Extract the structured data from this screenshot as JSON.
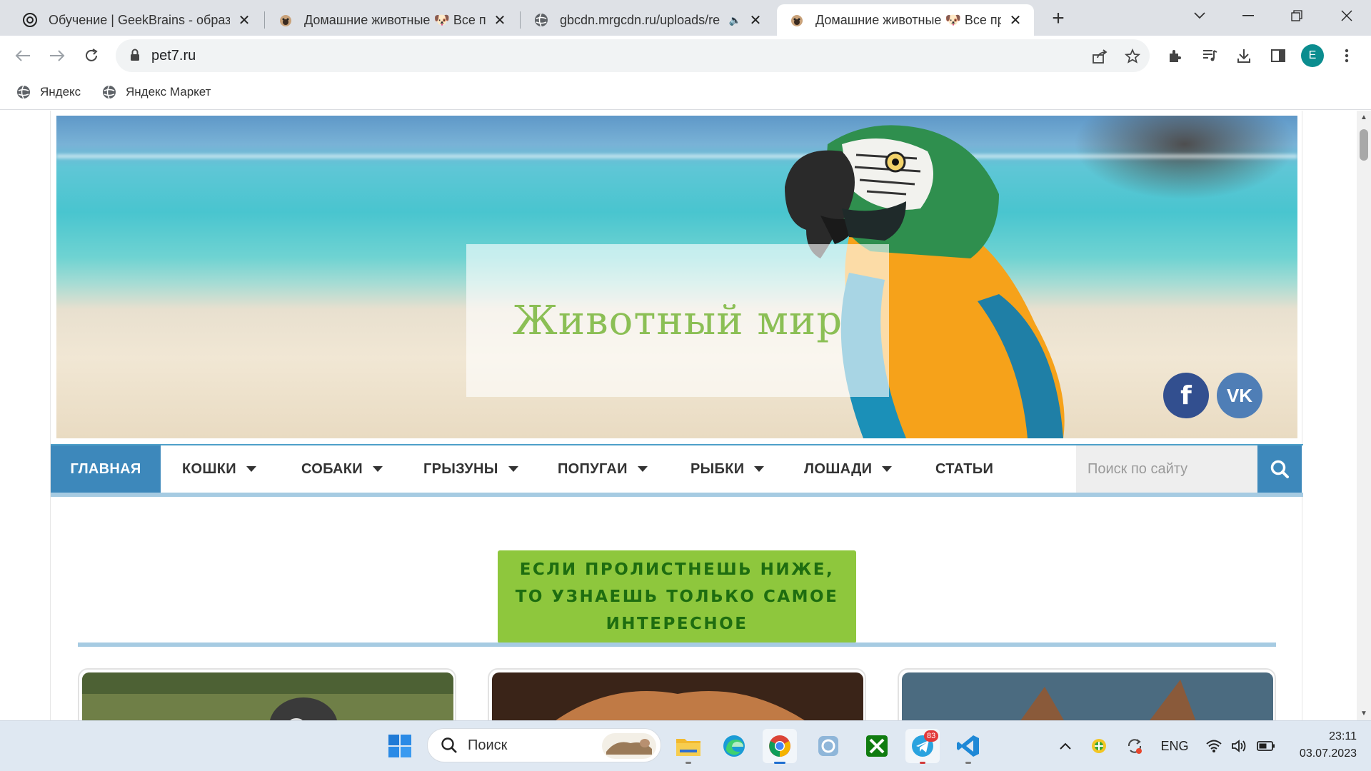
{
  "browser": {
    "tabs": [
      {
        "title": "Обучение | GeekBrains - образо",
        "active": false
      },
      {
        "title": "Домашние животные 🐶 Все пр",
        "active": false
      },
      {
        "title": "gbcdn.mrgcdn.ru/uploads/re",
        "active": false
      },
      {
        "title": "Домашние животные 🐶 Все пр",
        "active": true
      }
    ],
    "url": "pet7.ru",
    "profile_initial": "E",
    "bookmarks": [
      "Яндекс",
      "Яндекс Маркет"
    ]
  },
  "site": {
    "hero_title": "Животный мир",
    "social": {
      "fb_label": "f",
      "vk_label": "VK"
    },
    "nav": [
      {
        "label": "ГЛАВНАЯ",
        "dropdown": false,
        "active": true
      },
      {
        "label": "КОШКИ",
        "dropdown": true
      },
      {
        "label": "СОБАКИ",
        "dropdown": true
      },
      {
        "label": "ГРЫЗУНЫ",
        "dropdown": true
      },
      {
        "label": "ПОПУГАИ",
        "dropdown": true
      },
      {
        "label": "РЫБКИ",
        "dropdown": true
      },
      {
        "label": "ЛОШАДИ",
        "dropdown": true
      },
      {
        "label": "СТАТЬИ",
        "dropdown": false
      }
    ],
    "search_placeholder": "Поиск по сайту",
    "banner_lines": [
      "Если пролистнешь ниже,",
      "то узнаешь только самое",
      "интересное"
    ]
  },
  "taskbar": {
    "search_label": "Поиск",
    "telegram_badge": "83",
    "lang": "ENG",
    "time": "23:11",
    "date": "03.07.2023"
  },
  "colors": {
    "accent_blue": "#3d88bb",
    "banner_green": "#8ec73d",
    "banner_text": "#1e6d10",
    "hero_title": "#8bbf55"
  }
}
